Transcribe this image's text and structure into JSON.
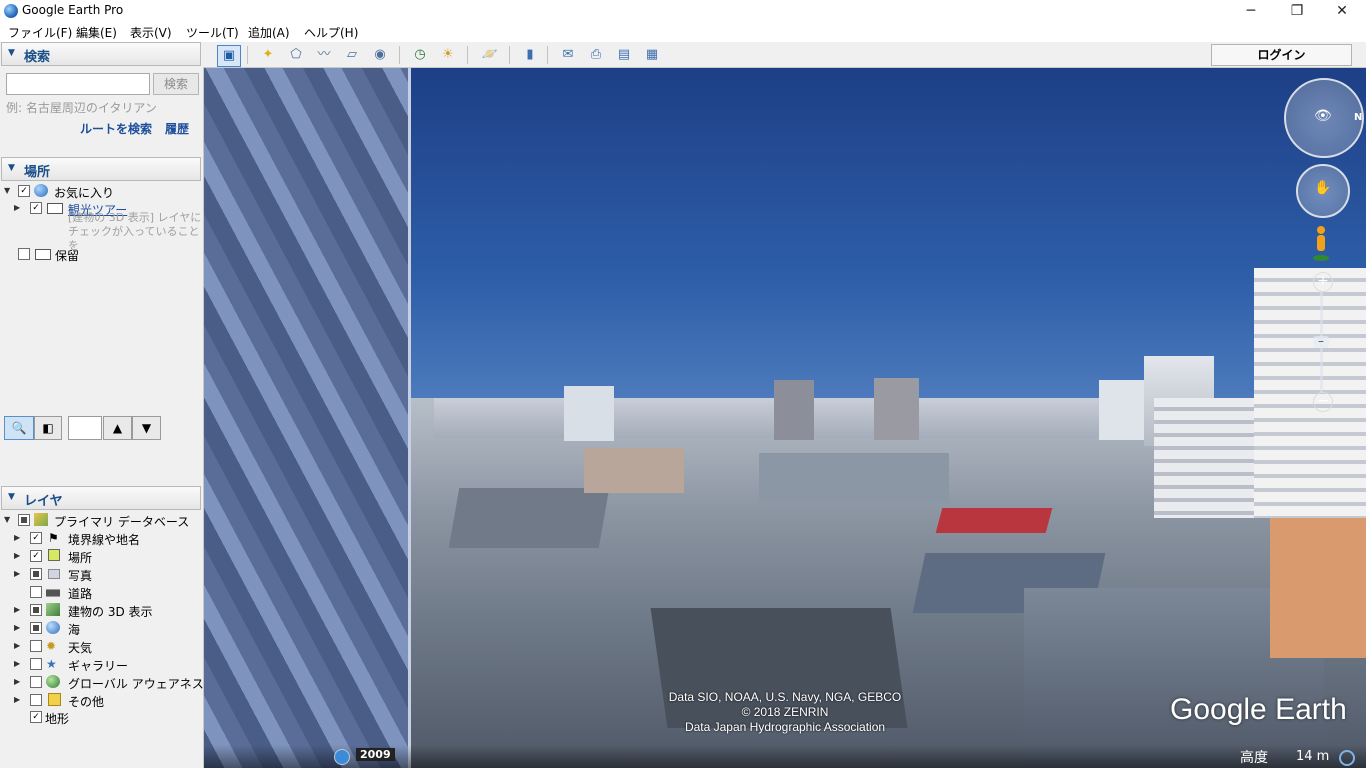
{
  "window": {
    "title": "Google Earth Pro",
    "minimize": "─",
    "maximize": "❐",
    "close": "✕"
  },
  "menu": [
    "ファイル(F)",
    "編集(E)",
    "表示(V)",
    "ツール(T)",
    "追加(A)",
    "ヘルプ(H)"
  ],
  "search": {
    "header": "検索",
    "input_value": "",
    "button": "検索",
    "hint": "例: 名古屋周辺のイタリアン",
    "route_link": "ルートを検索",
    "history_link": "履歴"
  },
  "places": {
    "header": "場所",
    "favorites": "お気に入り",
    "tour": "観光ツアー",
    "tour_desc": "[建物の 3D 表示] レイヤにチェックが入っていることを",
    "temporary": "保留"
  },
  "layers": {
    "header": "レイヤ",
    "primary": "プライマリ データベース",
    "items": [
      "境界線や地名",
      "場所",
      "写真",
      "道路",
      "建物の 3D 表示",
      "海",
      "天気",
      "ギャラリー",
      "グローバル アウェアネス",
      "その他"
    ],
    "terrain": "地形"
  },
  "toolbar": {
    "login": "ログイン"
  },
  "viewport": {
    "attribution_1": "Data SIO, NOAA, U.S. Navy, NGA, GEBCO",
    "attribution_2": "© 2018 ZENRIN",
    "attribution_3": "Data Japan Hydrographic Association",
    "logo": "Google Earth",
    "compass_north": "N",
    "history_year": "2009",
    "altitude_label": "高度",
    "altitude_value": "14 m"
  },
  "colors": {
    "accent": "#1a4f8a",
    "link": "#1e4e9c",
    "sky_top": "#1d3f86"
  }
}
